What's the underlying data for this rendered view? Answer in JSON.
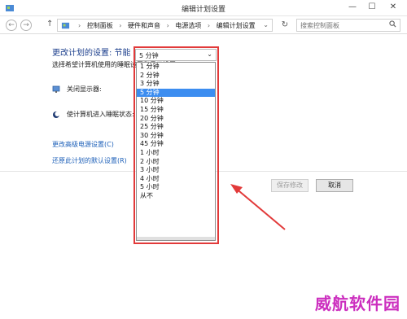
{
  "window": {
    "title": "编辑计划设置",
    "minimize": "—",
    "maximize": "☐",
    "close": "✕"
  },
  "nav": {
    "back": "←",
    "forward": "→",
    "up": "↑",
    "refresh": "↻",
    "dropdown": "⌄",
    "breadcrumbs": [
      "控制面板",
      "硬件和声音",
      "电源选项",
      "编辑计划设置"
    ],
    "breadcrumb_separator": "›",
    "search_placeholder": "搜索控制面板"
  },
  "main": {
    "heading": "更改计划的设置: 节能",
    "subheading": "选择希望计算机使用的睡眠设置和显示设置。",
    "display_off_label": "关闭显示器:",
    "sleep_label": "使计算机进入睡眠状态:",
    "advanced_link": "更改高级电源设置(C)",
    "restore_link": "还原此计划的默认设置(R)",
    "save_button": "保存修改",
    "cancel_button": "取消"
  },
  "select": {
    "value": "5 分钟",
    "options": [
      "1 分钟",
      "2 分钟",
      "3 分钟",
      "5 分钟",
      "10 分钟",
      "15 分钟",
      "20 分钟",
      "25 分钟",
      "30 分钟",
      "45 分钟",
      "1 小时",
      "2 小时",
      "3 小时",
      "4 小时",
      "5 小时",
      "从不"
    ],
    "selected_index": 3
  },
  "colors": {
    "heading": "#1b3e8c",
    "link": "#1c5fb8",
    "selection": "#3c8df0",
    "annotation": "#e23a3a",
    "watermark": "#cc2fbf"
  },
  "watermark": "威航软件园"
}
